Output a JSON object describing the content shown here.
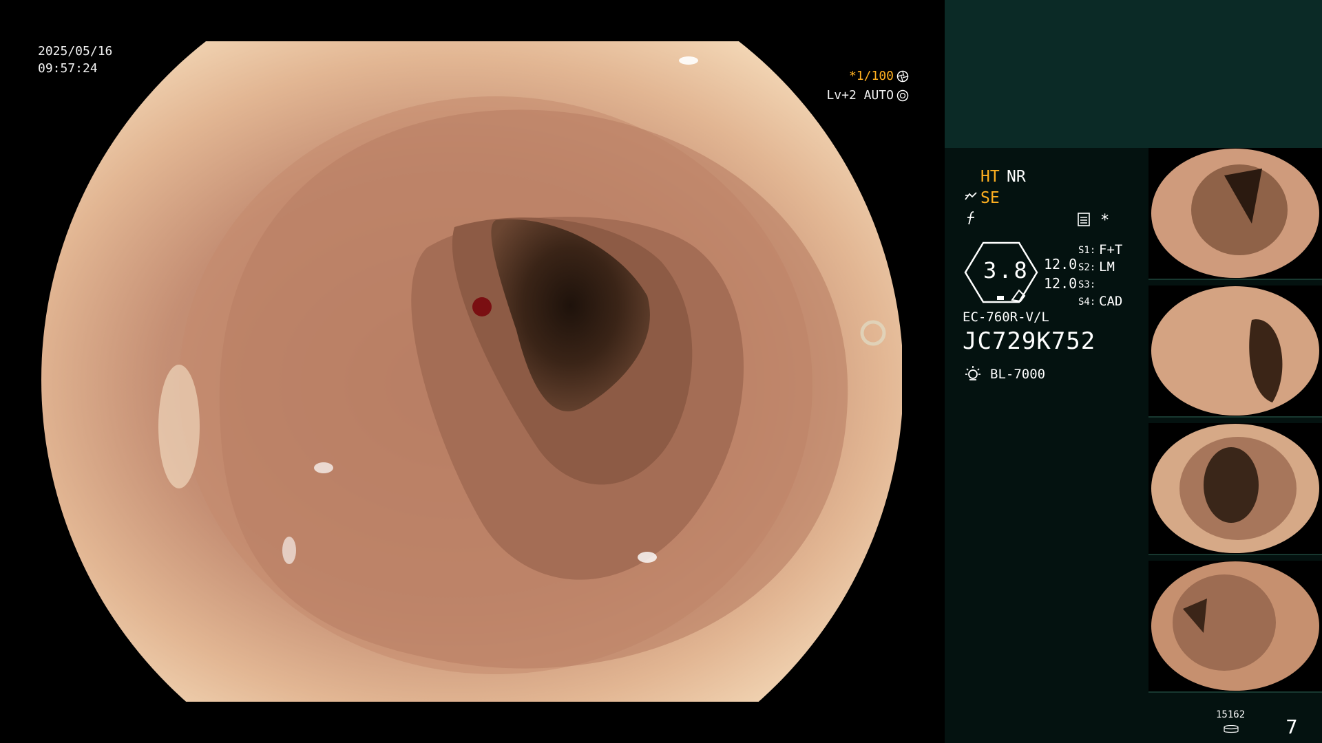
{
  "overlay": {
    "date": "2025/05/16",
    "time": "09:57:24",
    "shutter": "*1/100",
    "level": "Lv+2 AUTO"
  },
  "panel": {
    "ht": "HT",
    "nr": "NR",
    "se": "SE",
    "star": "*",
    "bubble_value": "3.8",
    "value1": "12.0",
    "value2": "12.0",
    "slots": [
      {
        "key": "S1:",
        "value": "F+T"
      },
      {
        "key": "S2:",
        "value": "LM"
      },
      {
        "key": "S3:",
        "value": ""
      },
      {
        "key": "S4:",
        "value": "CAD"
      }
    ],
    "model": "EC-760R-V/L",
    "serial": "JC729K752",
    "light_source": "BL-7000",
    "counter": "15162",
    "page": "7"
  },
  "colors": {
    "accent_orange": "#ffb020",
    "panel_top": "#0b2a26",
    "panel_bottom": "#041210"
  },
  "icons": {
    "shutter": "aperture-icon",
    "level": "iris-icon",
    "se": "enhance-icon",
    "f": "freeze-icon",
    "capture": "capture-icon",
    "light": "light-source-icon",
    "counter": "storage-icon"
  }
}
